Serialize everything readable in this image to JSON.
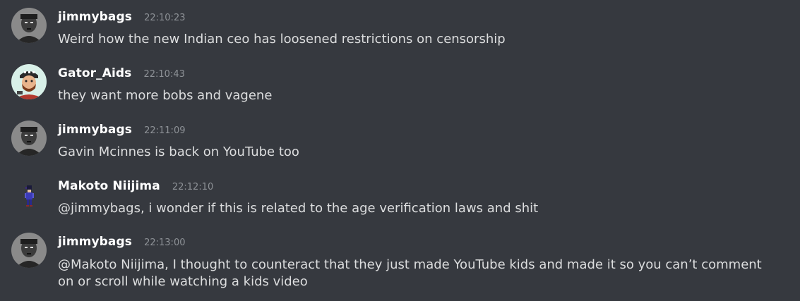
{
  "messages": [
    {
      "username": "jimmybags",
      "timestamp": "22:10:23",
      "text": "Weird how the new Indian ceo has loosened restrictions on censorship",
      "avatar_icon": "grayscale-portrait-avatar"
    },
    {
      "username": "Gator_Aids",
      "timestamp": "22:10:43",
      "text": "they want more bobs and vagene",
      "avatar_icon": "cartoon-bearded-man-avatar"
    },
    {
      "username": "jimmybags",
      "timestamp": "22:11:09",
      "text": "Gavin Mcinnes is back on YouTube too",
      "avatar_icon": "grayscale-portrait-avatar"
    },
    {
      "username": "Makoto Niijima",
      "timestamp": "22:12:10",
      "text": "@jimmybags, i wonder if this is related to the age verification laws and shit",
      "avatar_icon": "pixel-sprite-avatar"
    },
    {
      "username": "jimmybags",
      "timestamp": "22:13:00",
      "text": "@Makoto Niijima, I thought to counteract that they just made YouTube kids and made it so you can’t comment on or scroll while watching a kids video",
      "avatar_icon": "grayscale-portrait-avatar"
    }
  ],
  "colors": {
    "background": "#36393f",
    "username": "#ffffff",
    "timestamp": "#8e9297",
    "text": "#dcddde"
  }
}
